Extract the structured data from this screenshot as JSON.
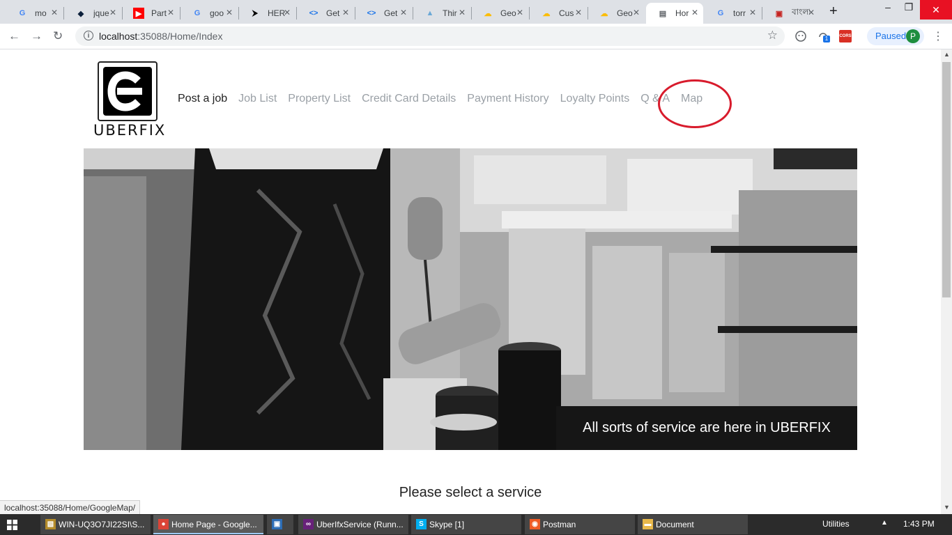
{
  "browser": {
    "tabs": [
      {
        "title": "mo",
        "favicon": "google-icon",
        "active": false
      },
      {
        "title": "jque",
        "favicon": "jquery-icon",
        "active": false
      },
      {
        "title": "Part",
        "favicon": "youtube-icon",
        "active": false
      },
      {
        "title": "goo",
        "favicon": "google-icon",
        "active": false
      },
      {
        "title": "HER",
        "favicon": "heroku-icon",
        "active": false
      },
      {
        "title": "Get",
        "favicon": "code-icon",
        "active": false
      },
      {
        "title": "Get",
        "favicon": "code-icon",
        "active": false
      },
      {
        "title": "Thir",
        "favicon": "shell-icon",
        "active": false
      },
      {
        "title": "Geo",
        "favicon": "gcloud-icon",
        "active": false
      },
      {
        "title": "Cus",
        "favicon": "gcloud-icon",
        "active": false
      },
      {
        "title": "Geo",
        "favicon": "gcloud-icon",
        "active": false
      },
      {
        "title": "Hor",
        "favicon": "page-icon",
        "active": true
      },
      {
        "title": "torr",
        "favicon": "google-icon",
        "active": false
      },
      {
        "title": "বাংলা",
        "favicon": "bengali-site-icon",
        "active": false
      }
    ],
    "url_host": "localhost",
    "url_path": ":35088/Home/Index",
    "profile_status": "Paused",
    "profile_initial": "P",
    "extension_badge": "1",
    "cors_label": "CORS",
    "status_bar_url": "localhost:35088/Home/GoogleMap/"
  },
  "site": {
    "logo_text": "UBERFIX",
    "nav": [
      "Post a job",
      "Job List",
      "Property List",
      "Credit Card Details",
      "Payment History",
      "Loyalty Points",
      "Q & A",
      "Map"
    ],
    "hero_caption": "All sorts of service are here in UBERFIX",
    "section_title": "Please select a service",
    "annotation_color": "#d81b2c"
  },
  "taskbar": {
    "items": [
      {
        "label": "WIN-UQ3O7JI22SI\\S...",
        "icon": "sql-server-icon",
        "active": false
      },
      {
        "label": "Home Page - Google...",
        "icon": "chrome-icon",
        "active": true
      },
      {
        "label": "",
        "icon": "remote-desktop-icon",
        "active": false
      },
      {
        "label": "UberIfxService (Runn...",
        "icon": "visual-studio-icon",
        "active": false
      },
      {
        "label": "Skype [1]",
        "icon": "skype-icon",
        "active": false
      },
      {
        "label": "Postman",
        "icon": "postman-icon",
        "active": false
      },
      {
        "label": "Document",
        "icon": "folder-icon",
        "active": false
      }
    ],
    "tray_label": "Utilities",
    "clock": "1:43 PM"
  }
}
